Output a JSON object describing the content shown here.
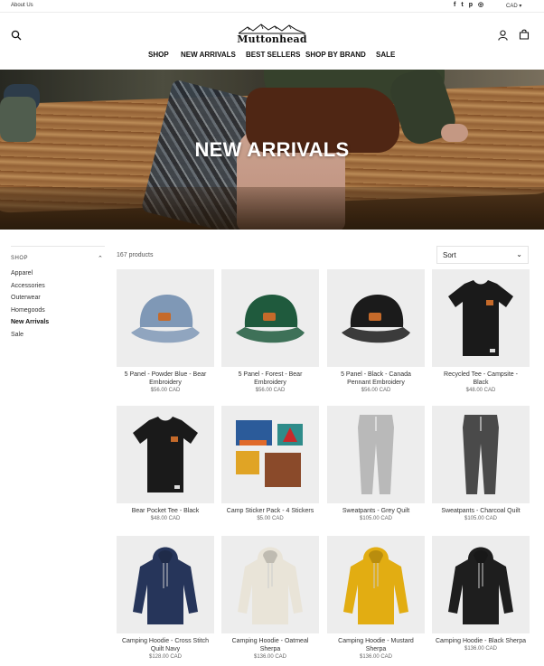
{
  "utility": {
    "about_label": "About Us",
    "currency": "CAD",
    "socials": [
      {
        "icon": "facebook-icon",
        "glyph": "f"
      },
      {
        "icon": "twitter-icon",
        "glyph": "t"
      },
      {
        "icon": "pinterest-icon",
        "glyph": "p"
      },
      {
        "icon": "instagram-icon",
        "glyph": "◎"
      }
    ]
  },
  "header": {
    "logo_text": "Muttonhead",
    "nav": [
      "SHOP",
      "NEW ARRIVALS",
      "BEST SELLERS",
      "SHOP BY BRAND",
      "SALE"
    ]
  },
  "hero": {
    "title": "NEW ARRIVALS"
  },
  "sidebar": {
    "heading": "SHOP",
    "items": [
      {
        "label": "Apparel",
        "active": false
      },
      {
        "label": "Accessories",
        "active": false
      },
      {
        "label": "Outerwear",
        "active": false
      },
      {
        "label": "Homegoods",
        "active": false
      },
      {
        "label": "New Arrivals",
        "active": true
      },
      {
        "label": "Sale",
        "active": false
      }
    ]
  },
  "listing": {
    "count": "167 products",
    "sort_label": "Sort"
  },
  "products": [
    {
      "name": "5 Panel - Powder Blue - Bear Embroidery",
      "price": "$56.00 CAD",
      "kind": "cap",
      "color": "#7f98b6"
    },
    {
      "name": "5 Panel - Forest - Bear Embroidery",
      "price": "$56.00 CAD",
      "kind": "cap",
      "color": "#1f5a3d"
    },
    {
      "name": "5 Panel - Black - Canada Pennant Embroidery",
      "price": "$56.00 CAD",
      "kind": "cap",
      "color": "#1b1b1b"
    },
    {
      "name": "Recycled Tee - Campsite - Black",
      "price": "$48.00 CAD",
      "kind": "tee",
      "color": "#1a1a1a"
    },
    {
      "name": "Bear Pocket Tee - Black",
      "price": "$48.00 CAD",
      "kind": "tee",
      "color": "#1a1a1a"
    },
    {
      "name": "Camp Sticker Pack - 4 Stickers",
      "price": "$5.00 CAD",
      "kind": "stickers",
      "color": "#2b5b9a"
    },
    {
      "name": "Sweatpants - Grey Quilt",
      "price": "$105.00 CAD",
      "kind": "pants",
      "color": "#b9b9b9"
    },
    {
      "name": "Sweatpants - Charcoal Quilt",
      "price": "$105.00 CAD",
      "kind": "pants",
      "color": "#4a4a4a"
    },
    {
      "name": "Camping Hoodie - Cross Stitch Quilt Navy",
      "price": "$128.00 CAD",
      "kind": "hoodie",
      "color": "#26355a"
    },
    {
      "name": "Camping Hoodie - Oatmeal Sherpa",
      "price": "$136.00 CAD",
      "kind": "hoodie",
      "color": "#e9e4d8"
    },
    {
      "name": "Camping Hoodie - Mustard Sherpa",
      "price": "$136.00 CAD",
      "kind": "hoodie",
      "color": "#e2ad12"
    },
    {
      "name": "Camping Hoodie - Black Sherpa",
      "price": "$136.00 CAD",
      "kind": "hoodie",
      "color": "#1e1e1e"
    }
  ]
}
